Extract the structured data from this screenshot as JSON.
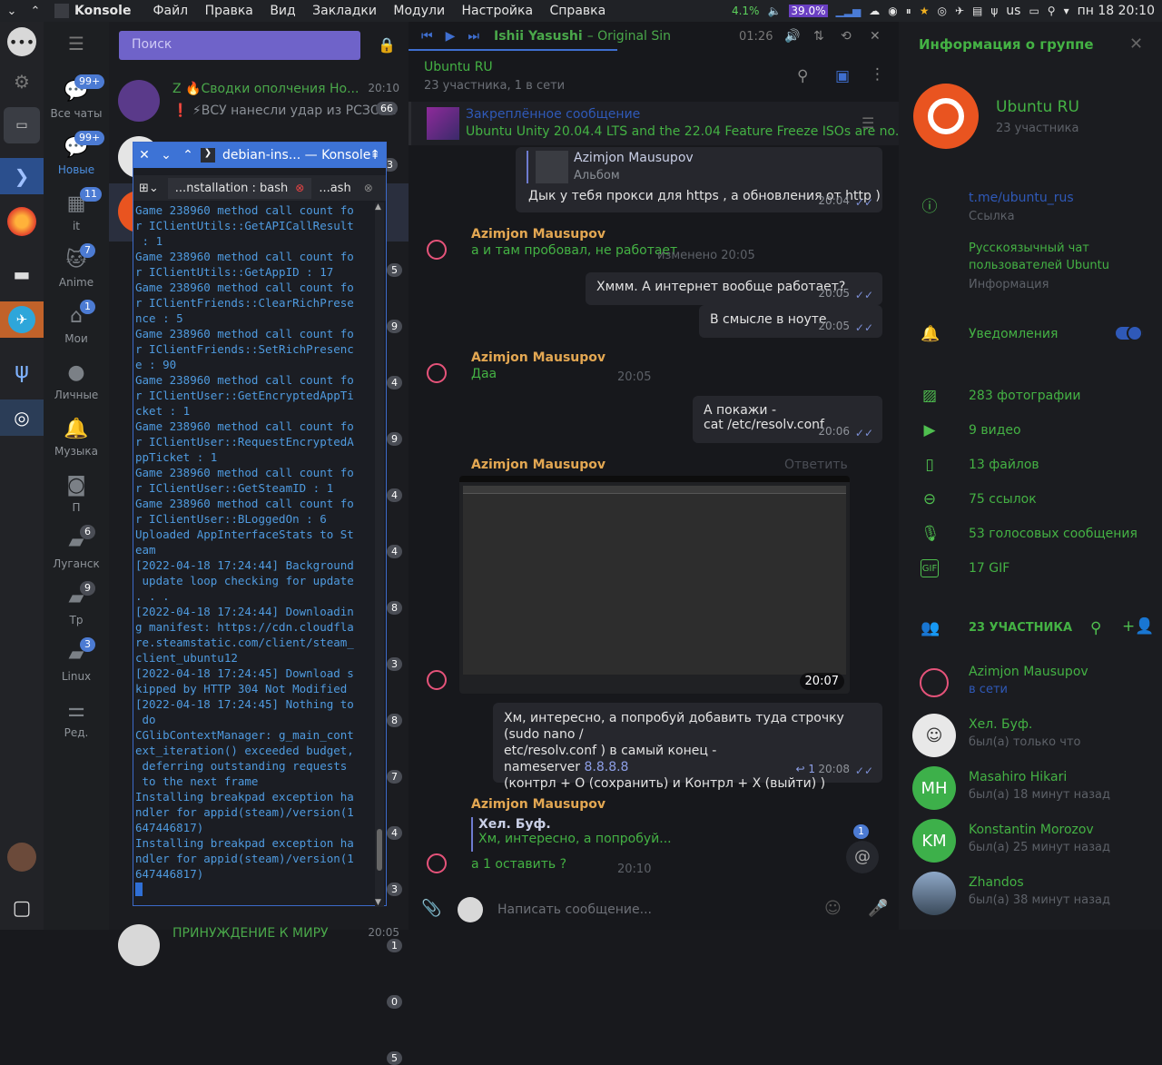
{
  "panel": {
    "app_name": "Konsole",
    "menu": [
      "Файл",
      "Правка",
      "Вид",
      "Закладки",
      "Модули",
      "Настройка",
      "Справка"
    ],
    "cpu": "4.1%",
    "mem": "39.0%",
    "layout": "us",
    "clock": "пн 18 20:10"
  },
  "folders": [
    {
      "label": "Все чаты",
      "badge": "99+"
    },
    {
      "label": "Новые",
      "badge": "99+"
    },
    {
      "label": "it",
      "badge": "11"
    },
    {
      "label": "Anime",
      "badge": "7"
    },
    {
      "label": "Мои",
      "badge": "1"
    },
    {
      "label": "Личные",
      "badge": ""
    },
    {
      "label": "Музыка",
      "badge": ""
    },
    {
      "label": "П",
      "badge": ""
    },
    {
      "label": "Луганск",
      "badge": "6"
    },
    {
      "label": "Тр",
      "badge": "9"
    },
    {
      "label": "Linux",
      "badge": "3"
    },
    {
      "label": "Ред.",
      "badge": ""
    }
  ],
  "chatlist": {
    "search_placeholder": "Поиск",
    "chats": [
      {
        "name": "Z 🔥Сводки ополчения Но...",
        "time": "20:10",
        "preview": "❗ ⚡ВСУ нанесли удар из РСЗО ...",
        "unread": "66"
      },
      {
        "name": "",
        "time": "",
        "preview": "",
        "unread": "3"
      }
    ],
    "side_counts": [
      "5",
      "9",
      "4",
      "9",
      "4",
      "4",
      "8",
      "3",
      "8",
      "7",
      "4",
      "3",
      "1",
      "0",
      "5"
    ],
    "bottom_name": "ПРИНУЖДЕНИЕ К МИРУ",
    "bottom_time": "20:05"
  },
  "konsole": {
    "title": "debian-ins... — Konsole",
    "tab1": "...nstallation : bash",
    "tab2": "...ash",
    "lines": [
      "Game 238960 method call count fo",
      "r IClientUtils::GetAPICallResult",
      " : 1",
      "Game 238960 method call count fo",
      "r IClientUtils::GetAppID : 17",
      "Game 238960 method call count fo",
      "r IClientFriends::ClearRichPrese",
      "nce : 5",
      "Game 238960 method call count fo",
      "r IClientFriends::SetRichPresenc",
      "e : 90",
      "Game 238960 method call count fo",
      "r IClientUser::GetEncryptedAppTi",
      "cket : 1",
      "Game 238960 method call count fo",
      "r IClientUser::RequestEncryptedA",
      "ppTicket : 1",
      "Game 238960 method call count fo",
      "r IClientUser::GetSteamID : 1",
      "Game 238960 method call count fo",
      "r IClientUser::BLoggedOn : 6",
      "Uploaded AppInterfaceStats to St",
      "eam",
      "[2022-04-18 17:24:44] Background",
      " update loop checking for update",
      ". . .",
      "[2022-04-18 17:24:44] Downloadin",
      "g manifest: https://cdn.cloudfla",
      "re.steamstatic.com/client/steam_",
      "client_ubuntu12",
      "[2022-04-18 17:24:45] Download s",
      "kipped by HTTP 304 Not Modified",
      "[2022-04-18 17:24:45] Nothing to",
      " do",
      "CGlibContextManager: g_main_cont",
      "ext_iteration() exceeded budget,",
      " deferring outstanding requests",
      " to the next frame",
      "Installing breakpad exception ha",
      "ndler for appid(steam)/version(1",
      "647446817)",
      "Installing breakpad exception ha",
      "ndler for appid(steam)/version(1",
      "647446817)"
    ]
  },
  "player": {
    "artist": "Ishii Yasushi",
    "track": "– Original Sin",
    "time": "01:26"
  },
  "chat": {
    "title": "Ubuntu RU",
    "status": "23 участника, 1 в сети",
    "pinned_label": "Закреплённое сообщение",
    "pinned_text": "Ubuntu Unity 20.04.4 LTS and the 22.04 Feature Freeze ISOs are no...",
    "messages": {
      "m1_reply_name": "Azimjon Mausupov",
      "m1_reply_text": "Альбом",
      "m1_text": "Дык у тебя прокси для https , а обновления от http )",
      "m1_time": "20:04",
      "m2_sender": "Azimjon Mausupov",
      "m2_text": "а и там пробовал, не работает",
      "m2_time": "изменено 20:05",
      "m3_text": "Хммм. А интернет вообще работает?",
      "m3_time": "20:05",
      "m4_text": "В смысле в ноуте",
      "m4_time": "20:05",
      "m5_sender": "Azimjon Mausupov",
      "m5_text": "Даа",
      "m5_time": "20:05",
      "m6_line1": "А покажи  -",
      "m6_line2": "cat /etc/resolv.conf",
      "m6_time": "20:06",
      "m7_sender": "Azimjon Mausupov",
      "m7_reply": "Ответить",
      "m7_time": "20:07",
      "m8_l1": "Хм, интересно, а попробуй добавить туда строчку (sudo nano /",
      "m8_l2": "etc/resolv.conf ) в самый конец -",
      "m8_l3a": "nameserver ",
      "m8_l3b": "8.8.8.8",
      "m8_l4": "(контрл + О (сохранить) и Контрл + Х (выйти) )",
      "m8_replies": "1",
      "m8_time": "20:08",
      "m9_sender": "Azimjon Mausupov",
      "m9_reply_name": "Хел. Буф.",
      "m9_reply_text": "Хм, интересно, а попробуй...",
      "m9_text": "а 1 оставить ?",
      "m9_time": "20:10",
      "mention_count": "1"
    },
    "composer_placeholder": "Написать сообщение..."
  },
  "info": {
    "header": "Информация о группе",
    "name": "Ubuntu RU",
    "count": "23 участника",
    "link": "t.me/ubuntu_rus",
    "link_label": "Ссылка",
    "desc1": "Русскоязычный чат",
    "desc2": "пользователей Ubuntu",
    "desc_label": "Информация",
    "notifications": "Уведомления",
    "media": [
      "283 фотографии",
      "9 видео",
      "13 файлов",
      "75 ссылок",
      "53 голосовых сообщения",
      "17 GIF"
    ],
    "members_header": "23 УЧАСТНИКА",
    "members": [
      {
        "name": "Azimjon Mausupov",
        "status": "в сети",
        "initials": ""
      },
      {
        "name": "Хел. Буф.",
        "status": "был(а) только что",
        "initials": ""
      },
      {
        "name": "Masahiro Hikari",
        "status": "был(а) 18 минут назад",
        "initials": "MH"
      },
      {
        "name": "Konstantin Morozov",
        "status": "был(а) 25 минут назад",
        "initials": "KM"
      },
      {
        "name": "Zhandos",
        "status": "был(а) 38 минут назад",
        "initials": ""
      }
    ]
  },
  "colors": {
    "accent": "#44b244",
    "konsole_title": "#3d73d6",
    "search": "#6f63c9",
    "sender": "#e3a752",
    "term_text": "#4f9be0"
  }
}
